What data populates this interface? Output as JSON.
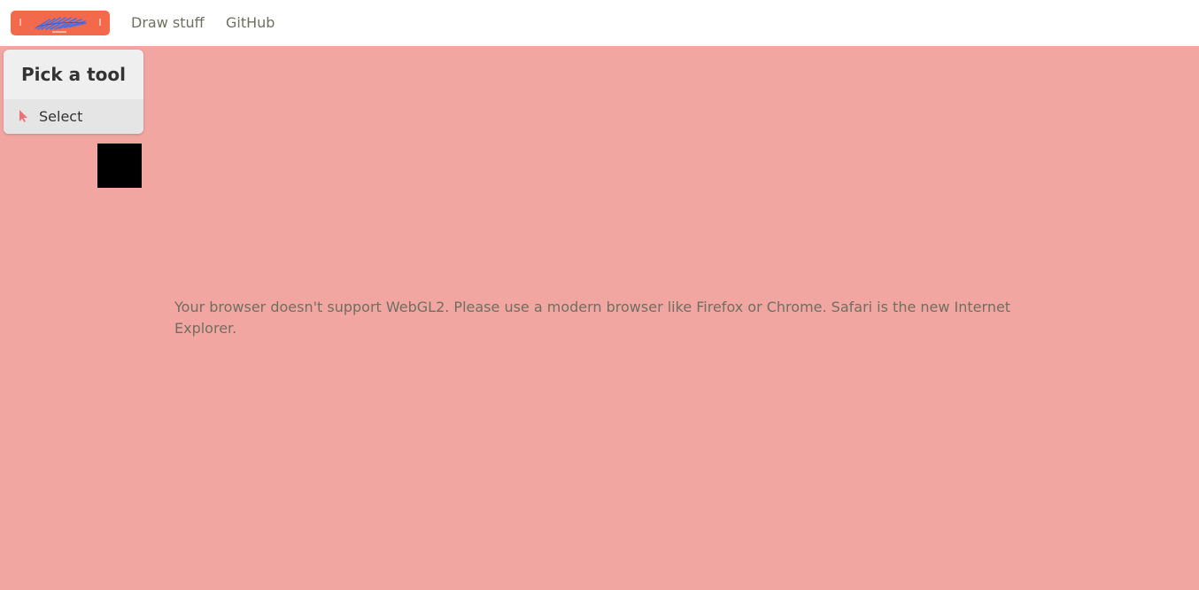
{
  "nav": {
    "logo_icon": "scribble-logo-icon",
    "links": [
      {
        "label": "Draw stuff"
      },
      {
        "label": "GitHub"
      }
    ]
  },
  "tool_panel": {
    "title": "Pick a tool",
    "tools": [
      {
        "label": "Select",
        "icon": "cursor-icon"
      }
    ]
  },
  "main": {
    "error_message": "Your browser doesn't support WebGL2. Please use a modern browser like Firefox or Chrome. Safari is the new Internet Explorer."
  },
  "colors": {
    "logo_bg": "#f26a4b",
    "logo_scribble": "#4b6fe0",
    "canvas_bg": "#f2a6a1",
    "cursor_icon": "#f0707a",
    "link_text": "#6f6f61"
  }
}
